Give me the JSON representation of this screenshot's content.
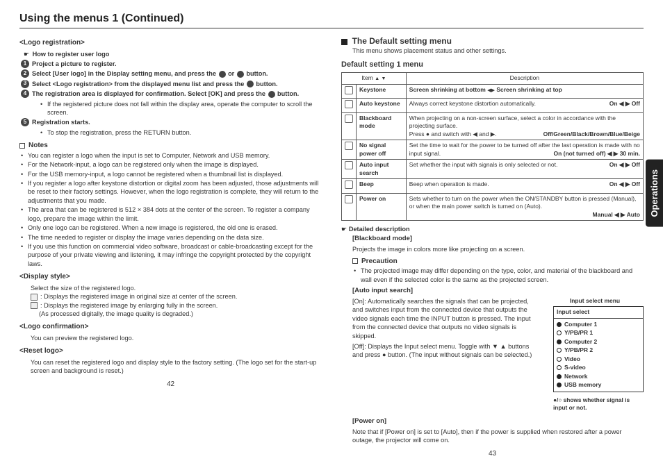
{
  "title": "Using the menus 1 (Continued)",
  "side_tab": "Operations",
  "page_left_num": "42",
  "page_right_num": "43",
  "left": {
    "logo_reg_h": "<Logo registration>",
    "how_to_h": "How to register user logo",
    "steps": {
      "s1": "Project a picture to register.",
      "s2a": "Select [User logo] in the Display setting menu, and press the ",
      "s2b": " or ",
      "s2c": " button.",
      "s3a": "Select <Logo registration> from the displayed menu list and press the ",
      "s3b": " button.",
      "s4a": "The registration area is displayed for confirmation. Select [OK] and press the ",
      "s4b": " button.",
      "s4_sub": "If the registered picture does not fall within the display area, operate the computer to scroll the screen.",
      "s5": "Registration starts.",
      "s5_sub": "To stop the registration, press the RETURN button."
    },
    "notes_h": "Notes",
    "notes": [
      "You can register a logo when the input is set to Computer, Network and USB memory.",
      "For the Network-input, a logo can be registered only when the image is displayed.",
      "For the USB memory-input, a logo cannot be registered when a thumbnail list is displayed.",
      "If you register a logo after keystone distortion or digital zoom has been adjusted, those adjustments will be reset to their factory settings. However, when the logo registration is complete, they will return to the adjustments that you made.",
      "The area that can be registered is 512 × 384 dots at the center of the screen. To register a company logo, prepare the image within the limit.",
      "Only one logo can be registered. When a new image is registered, the old one is erased.",
      "The time needed to register or display the image varies depending on the data size.",
      "If you use this function on commercial video software, broadcast or cable-broadcasting except for the purpose of your private viewing and listening, it may infringe the copyright protected by the copyright laws."
    ],
    "disp_style_h": "<Display style>",
    "disp_style_intro": "Select the size of the registered logo.",
    "disp_style_1": ": Displays the registered image in original size at center of the screen.",
    "disp_style_2": ": Displays the registered image by enlarging fully in the screen.",
    "disp_style_2b": "(As processed digitally, the image quality is degraded.)",
    "logo_conf_h": "<Logo confirmation>",
    "logo_conf_t": "You can preview the registered logo.",
    "reset_h": "<Reset logo>",
    "reset_t": "You can reset the registered logo and display style to the factory setting. (The logo set for the start-up screen and background is reset.)"
  },
  "right": {
    "default_h": "The Default setting menu",
    "default_sub": "This menu shows placement status and other settings.",
    "table_h": "Default setting 1 menu",
    "th_item_a": "Item ",
    "th_desc": "Description",
    "rows": {
      "r1_item": "Keystone",
      "r1_desc_a": "Screen shrinking at bottom ",
      "r1_desc_b": " Screen shrinking at top",
      "r2_item": "Auto keystone",
      "r2_desc": "Always correct keystone distortion automatically.",
      "r2_opt": "On ◀ ▶ Off",
      "r3_item": "Blackboard mode",
      "r3_desc_a": "When projecting on a non-screen surface, select a color in accordance with the projecting surface.",
      "r3_desc_b": "Press ● and switch with ◀ and ▶.",
      "r3_opt": "Off/Green/Black/Brown/Blue/Beige",
      "r4_item": "No signal power off",
      "r4_desc": "Set the time to wait for the power to be turned off after the last operation is made with no input signal.",
      "r4_opt": "On (not turned off) ◀ ▶ 30 min.",
      "r5_item": "Auto input search",
      "r5_desc": "Set whether the input with signals is only selected or not.",
      "r5_opt": "On ◀ ▶ Off",
      "r6_item": "Beep",
      "r6_desc": "Beep when operation is made.",
      "r6_opt": "On ◀ ▶ Off",
      "r7_item": "Power on",
      "r7_desc": "Sets whether to turn on the power when the ON/STANDBY button is pressed (Manual), or when the main power switch is turned on (Auto).",
      "r7_opt": "Manual ◀ ▶ Auto"
    },
    "detailed_h": "Detailed description",
    "bb_h": "[Blackboard mode]",
    "bb_t": "Projects the image in colors more like projecting on a screen.",
    "prec_h": "Precaution",
    "prec_t": "The projected image may differ depending on the type, color, and material of the blackboard and wall even if the selected color is the same as the projected screen.",
    "ais_h": "[Auto input search]",
    "ais_on": "[On]: Automatically searches the signals that can be projected, and switches input from the connected device that outputs the video signals each time the INPUT button is pressed. The input from the connected device that outputs no video signals is skipped.",
    "ais_off": "[Off]: Displays the Input select menu. Toggle with ▼ ▲ buttons and press ● button. (The input without signals can be selected.)",
    "input_select_title": "Input select menu",
    "input_select_hdr": "Input select",
    "input_items": [
      "Computer 1",
      "Y/PB/PR 1",
      "Computer 2",
      "Y/PB/PR 2",
      "Video",
      "S-video",
      "Network",
      "USB memory"
    ],
    "isel_note": "●/○ shows whether signal is input or not.",
    "power_on_h": "[Power on]",
    "power_on_t": "Note that if [Power on] is set to [Auto], then if the power is supplied when restored after a power outage, the projector will come on."
  }
}
